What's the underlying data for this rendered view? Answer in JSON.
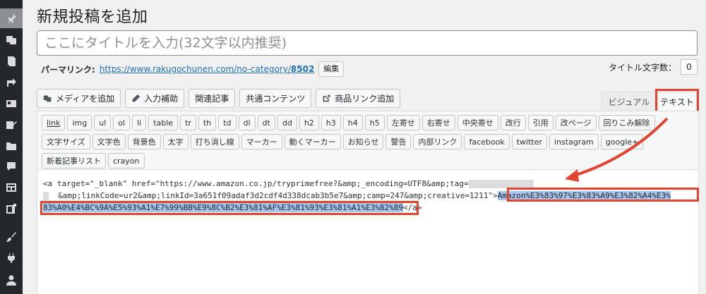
{
  "sidebar": {
    "icons": [
      "pin-icon",
      "media-icon",
      "pages-icon",
      "share-icon",
      "id-card-icon",
      "edit-icon",
      "folder-icon",
      "comment-icon",
      "layout-icon",
      "plugin-icon",
      "brush-icon",
      "plug-icon",
      "user-icon"
    ]
  },
  "page": {
    "title": "新規投稿を追加"
  },
  "title_input": {
    "placeholder": "ここにタイトルを入力(32文字以内推奨)"
  },
  "permalink": {
    "label": "パーマリンク:",
    "url_base": "https://www.rakugochunen.com/no-category/",
    "url_slug": "8502",
    "edit_label": "編集"
  },
  "title_count": {
    "label": "タイトル文字数：",
    "value": "0"
  },
  "media_buttons": {
    "add_media": "メディアを追加",
    "input_assist": "入力補助",
    "related": "関連記事",
    "shared": "共通コンテンツ",
    "product_link": "商品リンク追加"
  },
  "editor_tabs": {
    "visual": "ビジュアル",
    "text": "テキスト"
  },
  "toolbar": {
    "row1": [
      "link",
      "img",
      "ul",
      "ol",
      "li",
      "table",
      "tr",
      "th",
      "td",
      "dl",
      "dt",
      "dd",
      "h2",
      "h3",
      "h4",
      "h5",
      "左寄せ",
      "右寄せ",
      "中央寄せ",
      "改行",
      "引用",
      "改ページ",
      "回りこみ解除"
    ],
    "row2": [
      "文字サイズ",
      "文字色",
      "背景色",
      "太字",
      "打ち消し線",
      "マーカー",
      "動くマーカー",
      "お知らせ",
      "警告",
      "内部リンク",
      "facebook",
      "twitter",
      "instagram",
      "google+"
    ],
    "row3": [
      "新着記事リスト",
      "crayon"
    ]
  },
  "content": {
    "line1": "<a target=\"_blank\" href=\"https://www.amazon.co.jp/tryprimefree?&amp;_encoding=UTF8&amp;tag=",
    "line2_pre": "&amp;linkCode=ur2&amp;linkId=3a651f09adaf3d2cdf4d338dcab3b5e7&amp;camp=247&amp;creative=1211\">",
    "line2_sel": "Amazon%E3%83%97%E3%83%A9%E3%82%A4%E3%",
    "line3_sel": "83%A0%E4%BC%9A%E5%93%A1%E7%99%BB%E9%8C%B2%E3%81%AF%E3%81%93%E3%81%A1%E3%82%89",
    "line3_post": "</a>"
  },
  "colors": {
    "highlight_red": "#e2442f",
    "selection_blue": "#a8c5ee",
    "sidebar_dark": "#23282d",
    "link_blue": "#2271b1"
  }
}
